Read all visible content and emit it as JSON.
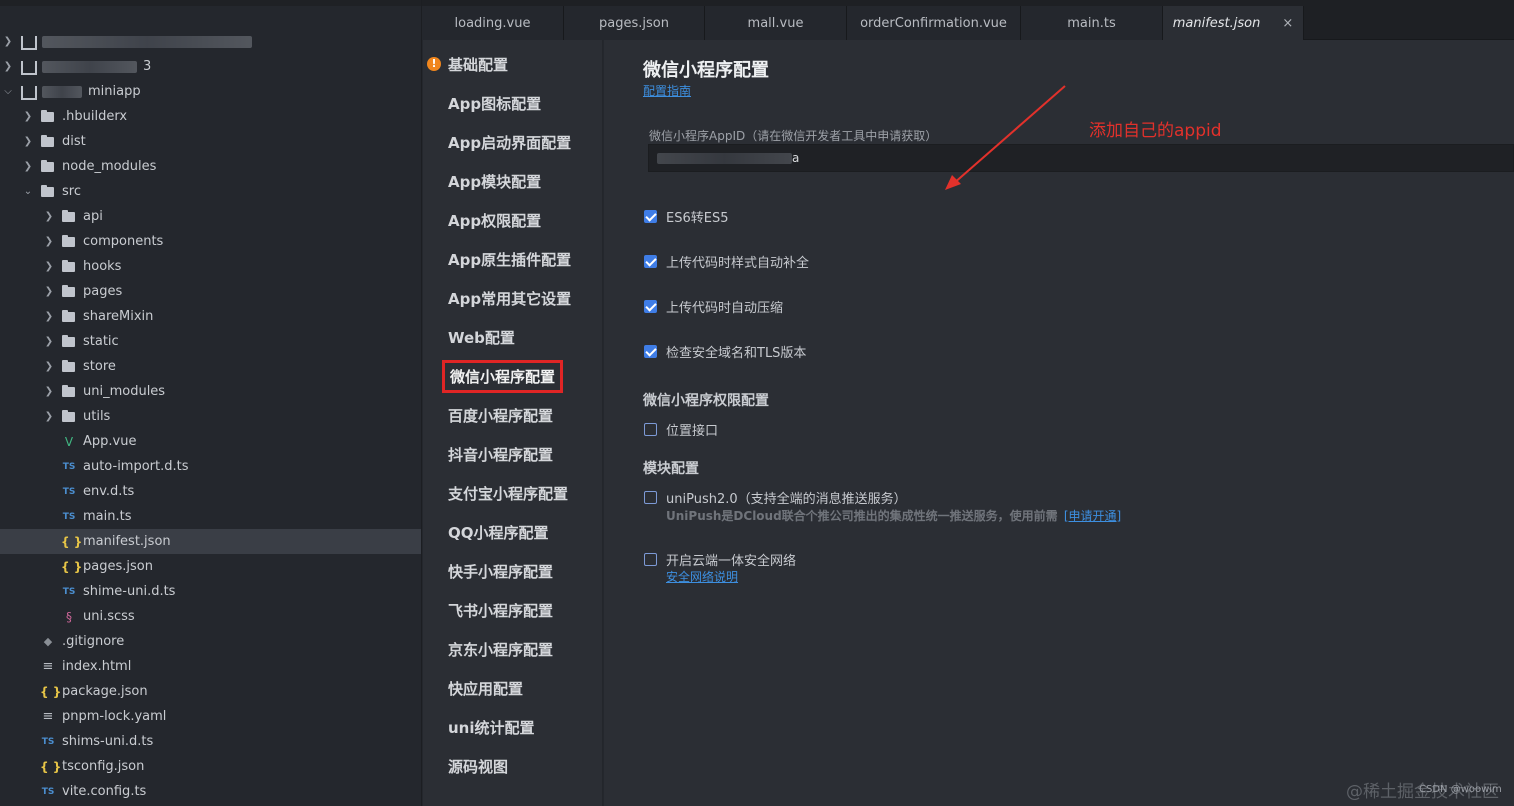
{
  "tabs": [
    {
      "label": "loading.vue",
      "active": false
    },
    {
      "label": "pages.json",
      "active": false
    },
    {
      "label": "mall.vue",
      "active": false
    },
    {
      "label": "orderConfirmation.vue",
      "active": false
    },
    {
      "label": "main.ts",
      "active": false
    },
    {
      "label": "manifest.json",
      "active": true
    }
  ],
  "tab_close_glyph": "×",
  "explorer": {
    "projects": [
      {
        "label": "",
        "redacted": true
      },
      {
        "label": "3",
        "redacted": true
      },
      {
        "label": "miniapp",
        "redacted": true
      }
    ],
    "items": [
      {
        "label": ".hbuilderx",
        "icon": "folder-icon"
      },
      {
        "label": "dist",
        "icon": "folder-icon"
      },
      {
        "label": "node_modules",
        "icon": "folder-icon"
      },
      {
        "label": "src",
        "icon": "folder-icon"
      },
      {
        "label": "api",
        "icon": "folder-icon"
      },
      {
        "label": "components",
        "icon": "folder-icon"
      },
      {
        "label": "hooks",
        "icon": "folder-icon"
      },
      {
        "label": "pages",
        "icon": "folder-icon"
      },
      {
        "label": "shareMixin",
        "icon": "folder-icon"
      },
      {
        "label": "static",
        "icon": "folder-icon"
      },
      {
        "label": "store",
        "icon": "folder-icon"
      },
      {
        "label": "uni_modules",
        "icon": "folder-icon"
      },
      {
        "label": "utils",
        "icon": "folder-icon"
      },
      {
        "label": "App.vue",
        "icon": "vue-file-icon"
      },
      {
        "label": "auto-import.d.ts",
        "icon": "ts-file-icon"
      },
      {
        "label": "env.d.ts",
        "icon": "ts-file-icon"
      },
      {
        "label": "main.ts",
        "icon": "ts-file-icon"
      },
      {
        "label": "manifest.json",
        "icon": "json-file-icon",
        "selected": true
      },
      {
        "label": "pages.json",
        "icon": "json-file-icon"
      },
      {
        "label": "shime-uni.d.ts",
        "icon": "ts-file-icon"
      },
      {
        "label": "uni.scss",
        "icon": "scss-file-icon"
      },
      {
        "label": ".gitignore",
        "icon": "git-file-icon"
      },
      {
        "label": "index.html",
        "icon": "text-file-icon"
      },
      {
        "label": "package.json",
        "icon": "json-file-icon"
      },
      {
        "label": "pnpm-lock.yaml",
        "icon": "text-file-icon"
      },
      {
        "label": "shims-uni.d.ts",
        "icon": "ts-file-icon"
      },
      {
        "label": "tsconfig.json",
        "icon": "json-file-icon"
      },
      {
        "label": "vite.config.ts",
        "icon": "ts-file-icon"
      }
    ]
  },
  "nav": {
    "items": [
      {
        "label": "基础配置",
        "warning": true
      },
      {
        "label": "App图标配置"
      },
      {
        "label": "App启动界面配置"
      },
      {
        "label": "App模块配置"
      },
      {
        "label": "App权限配置"
      },
      {
        "label": "App原生插件配置"
      },
      {
        "label": "App常用其它设置"
      },
      {
        "label": "Web配置"
      },
      {
        "label": "微信小程序配置",
        "highlighted": true
      },
      {
        "label": "百度小程序配置"
      },
      {
        "label": "抖音小程序配置"
      },
      {
        "label": "支付宝小程序配置"
      },
      {
        "label": "QQ小程序配置"
      },
      {
        "label": "快手小程序配置"
      },
      {
        "label": "飞书小程序配置"
      },
      {
        "label": "京东小程序配置"
      },
      {
        "label": "快应用配置"
      },
      {
        "label": "uni统计配置"
      },
      {
        "label": "源码视图"
      }
    ]
  },
  "main": {
    "title": "微信小程序配置",
    "guide_link": "配置指南",
    "appid_label": "微信小程序AppID（请在微信开发者工具中申请获取）",
    "appid_value_visible_suffix": "a",
    "annotation": "添加自己的appid",
    "checkboxes": [
      {
        "label": "ES6转ES5",
        "checked": true
      },
      {
        "label": "上传代码时样式自动补全",
        "checked": true
      },
      {
        "label": "上传代码时自动压缩",
        "checked": true
      },
      {
        "label": "检查安全域名和TLS版本",
        "checked": true
      }
    ],
    "permissions_heading": "微信小程序权限配置",
    "permissions": [
      {
        "label": "位置接口",
        "checked": false
      }
    ],
    "modules_heading": "模块配置",
    "modules": [
      {
        "label": "uniPush2.0（支持全端的消息推送服务）",
        "checked": false,
        "hint": "UniPush是DCloud联合个推公司推出的集成性统一推送服务，使用前需",
        "hint_link": "[申请开通]"
      },
      {
        "label": "开启云端一体安全网络",
        "checked": false,
        "link": "安全网络说明"
      }
    ]
  },
  "watermarks": {
    "juejin": "@稀土掘金技术社区",
    "csdn": "CSDN @woowim"
  },
  "colors": {
    "accent_blue": "#3f7de6",
    "highlight_red": "#e02525",
    "annotation_red": "#e2312b",
    "warning_orange": "#f0861d"
  }
}
